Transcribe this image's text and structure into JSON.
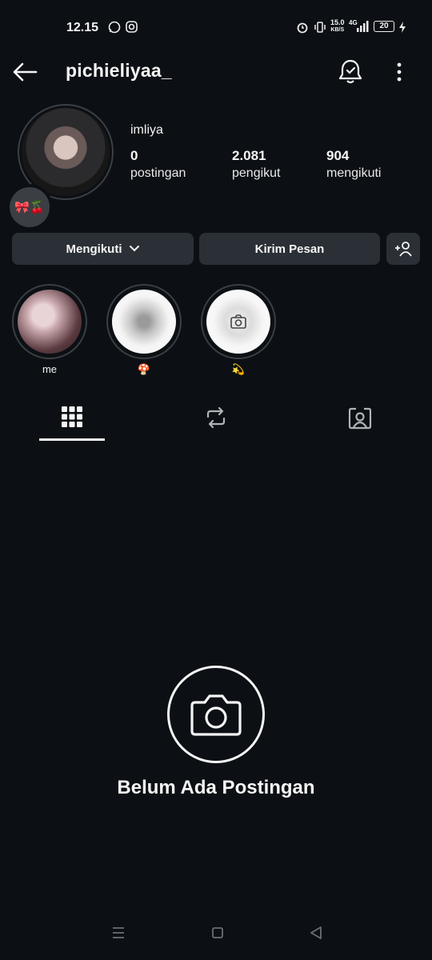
{
  "status_bar": {
    "time": "12.15",
    "net_speed_value": "15.0",
    "net_speed_unit": "KB/S",
    "network_type": "4G",
    "battery": "20",
    "icons": [
      "whatsapp-icon",
      "instagram-icon",
      "alarm-icon",
      "vibrate-icon",
      "signal-icon",
      "charging-icon"
    ]
  },
  "header": {
    "username": "pichieliyaa_",
    "icons": [
      "back-arrow-icon",
      "notification-bell-icon",
      "more-options-icon"
    ]
  },
  "profile": {
    "name": "imliya",
    "note_emoji": "🎀🍒",
    "stats": [
      {
        "value": "0",
        "label": "postingan"
      },
      {
        "value": "2.081",
        "label": "pengikut"
      },
      {
        "value": "904",
        "label": "mengikuti"
      }
    ]
  },
  "actions": {
    "following_label": "Mengikuti",
    "message_label": "Kirim Pesan",
    "add_person_icon": "add-person-icon"
  },
  "highlights": [
    {
      "label": "me"
    },
    {
      "label": "🍄"
    },
    {
      "label": "💫"
    }
  ],
  "tabs": {
    "items": [
      "grid-icon",
      "reels-repost-icon",
      "tagged-icon"
    ],
    "active": "grid-icon"
  },
  "empty_state": {
    "icon": "camera-icon",
    "text": "Belum Ada Postingan"
  },
  "colors": {
    "background": "#0c1014",
    "button": "#2b3036",
    "text": "#f5f5f5"
  }
}
